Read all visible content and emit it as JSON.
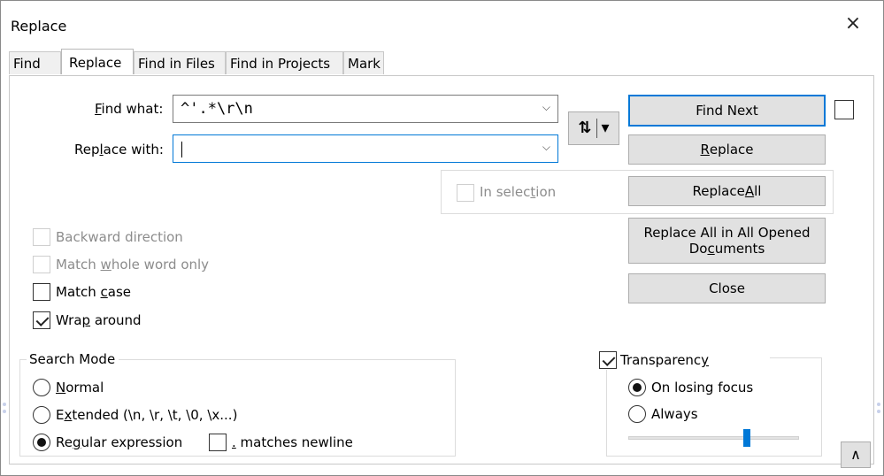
{
  "window": {
    "title": "Replace",
    "close_glyph": "×"
  },
  "tabs": [
    {
      "label": "Find"
    },
    {
      "label": "Replace"
    },
    {
      "label": "Find in Files"
    },
    {
      "label": "Find in Projects"
    },
    {
      "label": "Mark"
    }
  ],
  "find": {
    "label_pre": "",
    "label_ul": "F",
    "label_post": "ind what:",
    "value": "^'.*\\r\\n",
    "chevron": "⌵"
  },
  "replace_field": {
    "label_pre": "Rep",
    "label_ul": "l",
    "label_post": "ace with:",
    "value": "",
    "chevron": "⌵"
  },
  "swap_button": {
    "glyph": "⇅",
    "arrow": "▾"
  },
  "in_selection": {
    "pre": "In selec",
    "ul": "t",
    "post": "ion",
    "checked": false
  },
  "buttons": {
    "find_next": "Find Next",
    "replace_pre": "",
    "replace_ul": "R",
    "replace_post": "eplace",
    "replace_all_pre": "Replace ",
    "replace_all_ul": "A",
    "replace_all_post": "ll",
    "replace_all_opened_line1": "Replace All in All Opened",
    "replace_all_opened_line2_pre": "Do",
    "replace_all_opened_line2_ul": "c",
    "replace_all_opened_line2_post": "uments",
    "close": "Close"
  },
  "options": {
    "backward": {
      "label": "Backward direction",
      "checked": false
    },
    "whole_word": {
      "pre": "Match ",
      "ul": "w",
      "post": "hole word only",
      "checked": false
    },
    "match_case": {
      "pre": "Match ",
      "ul": "c",
      "post": "ase",
      "checked": false
    },
    "wrap": {
      "pre": "Wra",
      "ul": "p",
      "post": " around",
      "checked": true
    }
  },
  "search_mode": {
    "title": "Search Mode",
    "normal": {
      "pre": "",
      "ul": "N",
      "post": "ormal",
      "selected": false
    },
    "extended": {
      "pre": "E",
      "ul": "x",
      "post": "tended (\\n, \\r, \\t, \\0, \\x...)",
      "selected": false
    },
    "regex": {
      "pre": "Re",
      "ul": "g",
      "post": "ular expression",
      "selected": true
    },
    "dot_newline": {
      "ul": ".",
      "post": " matches newline",
      "checked": false
    }
  },
  "transparency": {
    "pre": "Transparenc",
    "ul": "y",
    "post": "",
    "checked": true,
    "on_losing_focus": {
      "label": "On losing focus",
      "selected": true
    },
    "always": {
      "label": "Always",
      "selected": false
    },
    "level": 0.7
  },
  "collapse_button": {
    "glyph": "∧"
  },
  "colors": {
    "accent": "#0078d7",
    "button_bg": "#e1e1e1"
  }
}
